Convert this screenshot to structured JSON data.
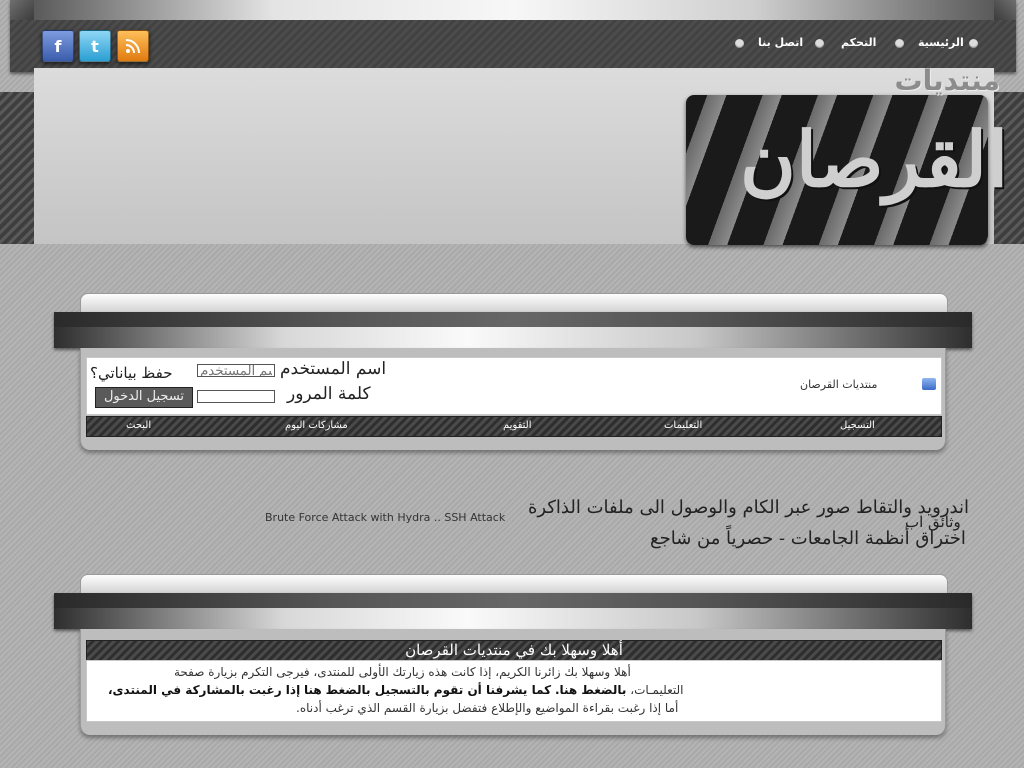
{
  "top_nav": {
    "home": "الرئيسية",
    "control": "التحكم",
    "contact": "اتصل بنا"
  },
  "social": {
    "facebook": "f",
    "twitter": "t",
    "rss": "rss-icon"
  },
  "header": {
    "logo_top": "منتديات",
    "logo_main": "القرصان"
  },
  "login": {
    "username_label": "اسم المستخدم",
    "username_placeholder": "اسم المستخدم",
    "password_label": "كلمة المرور",
    "remember": "حفظ بياناتي؟",
    "button": "تسجيل الدخول",
    "forum_name": "منتديات القرصان"
  },
  "navbar": {
    "register": "التسجيل",
    "instructions": "التعليمات",
    "calendar": "التقويم",
    "todays_posts": "مشاركات اليوم",
    "search": "البحث"
  },
  "news": {
    "line1": "اندرويد والتقاط صور عبر الكام والوصول الى ملفات الذاكرة",
    "line2": "وثائق اب",
    "line3": "اختراق أنظمة الجامعات - حصرياً من شاجع",
    "english": "Brute Force Attack with Hydra .. SSH Attack"
  },
  "welcome": {
    "title": "أهلا وسهلا بك في منتديات القرصان",
    "line1": "أهلا وسهلا بك زائرنا الكريم، إذا كانت هذه زيارتك الأولى للمنتدى، فيرجى التكرم بزيارة صفحة",
    "line2a": "التعليمـات،",
    "line2b": "بالضغط هنا.",
    "line2c": "كما يشرفنا أن تقوم بالتسجيل بالضغط",
    "line2d": "هنا",
    "line2e": "إذا رغبت بالمشاركة في المنتدى،",
    "line3": "أما إذا رغبت بقراءة المواضيع والإطلاع فتفضل بزيارة القسم الذي ترغب أدناه."
  },
  "colors": {
    "dark_bar": "#2e2e2e",
    "panel": "#bdbdbd",
    "accent_rss": "#e07b10",
    "accent_fb": "#3a5cab",
    "accent_tw": "#2a9fd3"
  }
}
